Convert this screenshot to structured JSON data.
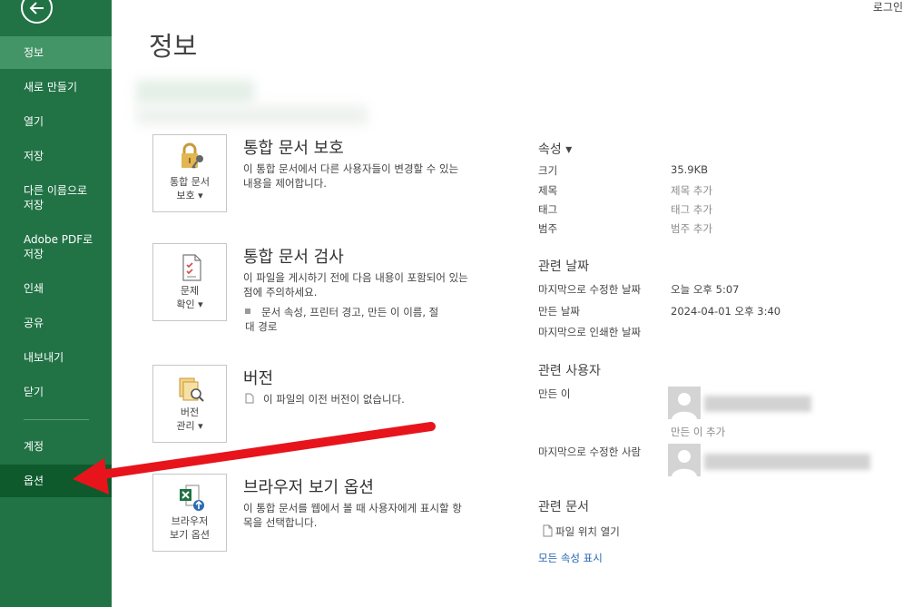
{
  "header": {
    "login": "로그인",
    "page_title": "정보"
  },
  "sidebar": {
    "items": [
      {
        "label": "정보"
      },
      {
        "label": "새로 만들기"
      },
      {
        "label": "열기"
      },
      {
        "label": "저장"
      },
      {
        "label": "다른 이름으로\n저장"
      },
      {
        "label": "Adobe PDF로\n저장"
      },
      {
        "label": "인쇄"
      },
      {
        "label": "공유"
      },
      {
        "label": "내보내기"
      },
      {
        "label": "닫기"
      },
      {
        "label": "계정"
      },
      {
        "label": "옵션"
      }
    ]
  },
  "sections": {
    "protect": {
      "card_label": "통합 문서\n보호 ▾",
      "title": "통합 문서 보호",
      "desc": "이 통합 문서에서 다른 사용자들이 변경할 수 있는 내용을 제어합니다."
    },
    "inspect": {
      "card_label": "문제\n확인 ▾",
      "title": "통합 문서 검사",
      "desc": "이 파일을 게시하기 전에 다음 내용이 포함되어 있는 점에 주의하세요.",
      "bullet": "문서 속성, 프린터 경고, 만든 이 이름, 절대 경로"
    },
    "version": {
      "card_label": "버전\n관리 ▾",
      "title": "버전",
      "desc": "이 파일의 이전 버전이 없습니다."
    },
    "browser": {
      "card_label": "브라우저\n보기 옵션",
      "title": "브라우저 보기 옵션",
      "desc": "이 통합 문서를 웹에서 볼 때 사용자에게 표시할 항목을 선택합니다."
    }
  },
  "properties": {
    "head": "속성 ▾",
    "rows": [
      {
        "label": "크기",
        "value": "35.9KB"
      },
      {
        "label": "제목",
        "value": "제목 추가"
      },
      {
        "label": "태그",
        "value": "태그 추가"
      },
      {
        "label": "범주",
        "value": "범주 추가"
      }
    ],
    "dates_head": "관련 날짜",
    "dates": [
      {
        "label": "마지막으로 수정한 날짜",
        "value": "오늘 오후 5:07"
      },
      {
        "label": "만든 날짜",
        "value": "2024-04-01 오후 3:40"
      },
      {
        "label": "마지막으로 인쇄한 날짜",
        "value": ""
      }
    ],
    "people_head": "관련 사용자",
    "creator_label": "만든 이",
    "add_creator": "만든 이 추가",
    "modifier_label": "마지막으로 수정한 사람",
    "docs_head": "관련 문서",
    "open_location": "파일 위치 열기",
    "show_all": "모든 속성 표시"
  },
  "colors": {
    "sidebar": "#217346",
    "sidebar_active": "#439467",
    "sidebar_selected": "#0e5a2d",
    "link": "#2467b0",
    "arrow": "#e8141c"
  }
}
